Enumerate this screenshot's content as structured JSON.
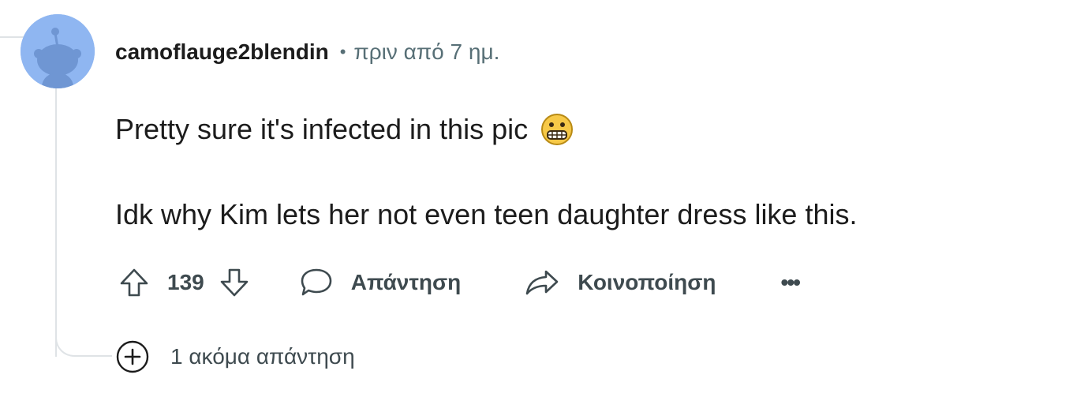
{
  "comment": {
    "author": "camoflauge2blendin",
    "separator": "•",
    "time_ago": "πριν από 7 ημ.",
    "body_line1": "Pretty sure it's infected in this pic",
    "emoji": "grimacing-face-emoji",
    "body_line2": "Idk why Kim lets her not even teen daughter dress like this.",
    "score": "139",
    "reply_label": "Απάντηση",
    "share_label": "Κοινοποίηση",
    "more_label": "•••",
    "more_replies_label": "1 ακόμα απάντηση"
  },
  "icons": {
    "avatar": "reddit-snoo-avatar",
    "upvote": "upvote-arrow-icon",
    "downvote": "downvote-arrow-icon",
    "reply": "speech-bubble-icon",
    "share": "share-arrow-icon",
    "expand": "plus-circle-icon"
  },
  "colors": {
    "avatar_bg": "#8fb6f1",
    "text": "#1c1c1c",
    "meta_text": "#576f76",
    "action_text": "#3e4a4f",
    "thread_line": "#dfe3e6"
  }
}
